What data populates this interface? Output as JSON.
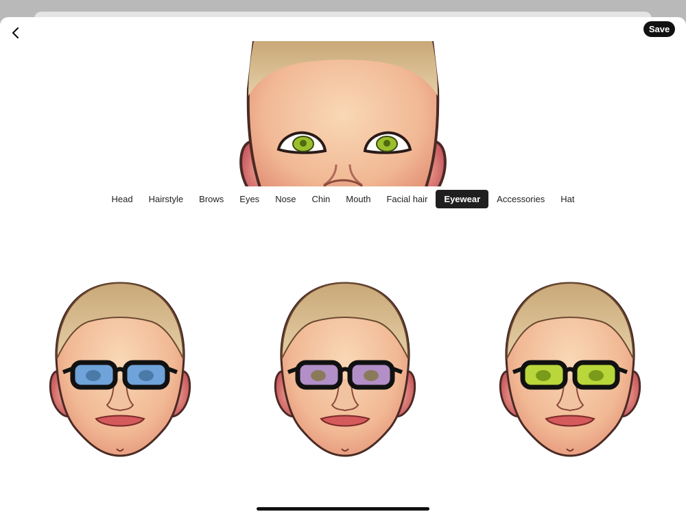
{
  "header": {
    "save_label": "Save"
  },
  "tabs": [
    {
      "label": "Head"
    },
    {
      "label": "Hairstyle"
    },
    {
      "label": "Brows"
    },
    {
      "label": "Eyes"
    },
    {
      "label": "Nose"
    },
    {
      "label": "Chin"
    },
    {
      "label": "Mouth"
    },
    {
      "label": "Facial hair"
    },
    {
      "label": "Eyewear"
    },
    {
      "label": "Accessories"
    },
    {
      "label": "Hat"
    }
  ],
  "active_tab": "Eyewear",
  "colors": {
    "skin": "#f2bd98",
    "hair": "#d6b98a",
    "ear": "#d9706e",
    "outline": "#4a2a24",
    "preview_iris": "#9bbf2a",
    "lens_options": [
      "#6fa3d9",
      "#b28fc7",
      "#b9d63a"
    ]
  },
  "icons": {
    "back": "chevron-left-icon"
  }
}
